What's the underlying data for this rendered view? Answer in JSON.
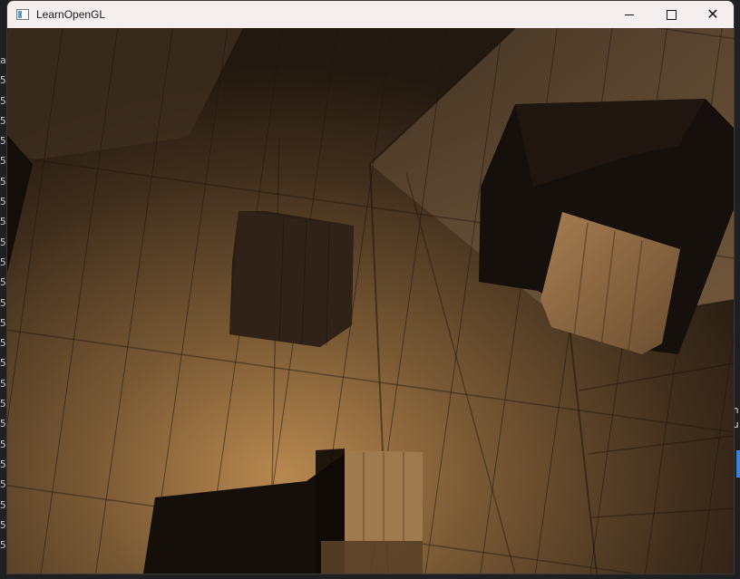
{
  "window": {
    "title": "LearnOpenGL",
    "controls": {
      "minimize": "minimize",
      "maximize": "maximize",
      "close": "close"
    }
  },
  "background_terminal": {
    "gutter_chars": [
      "a",
      "5",
      "5",
      "5",
      "5",
      "5",
      "5",
      "5",
      "5",
      "5",
      "5",
      "5",
      "5",
      "5",
      "5",
      "5",
      "5",
      "5",
      "5",
      "5",
      "5",
      "5",
      "5",
      "5",
      "5"
    ],
    "right_chars": [
      "n",
      "u"
    ]
  },
  "colors": {
    "titlebar": "#f5eeef",
    "wood_light": "#a07a4c",
    "wood_dark": "#3a2a18",
    "crate_dark": "#1c140d"
  },
  "icons": {
    "app": "window-app-icon",
    "minimize": "minimize-icon",
    "maximize": "maximize-icon",
    "close": "close-icon"
  }
}
